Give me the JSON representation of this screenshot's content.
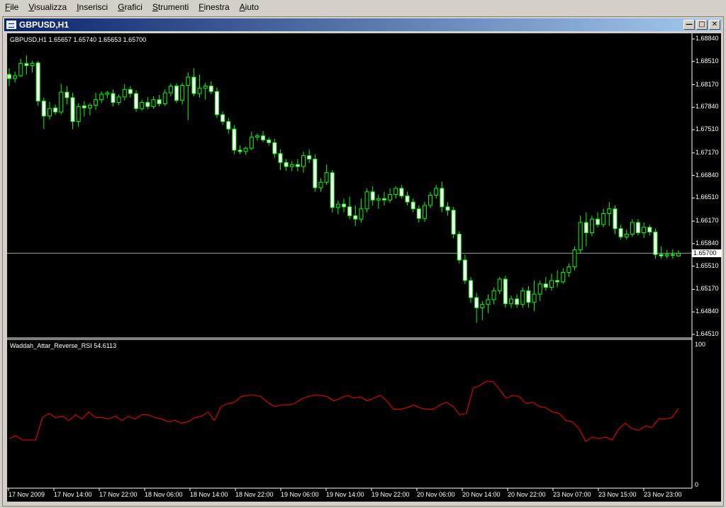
{
  "menu": [
    {
      "label": "File",
      "key": "F",
      "rest": "ile"
    },
    {
      "label": "Visualizza",
      "key": "V",
      "rest": "isualizza"
    },
    {
      "label": "Inserisci",
      "key": "I",
      "rest": "nserisci"
    },
    {
      "label": "Grafici",
      "key": "G",
      "rest": "rafici"
    },
    {
      "label": "Strumenti",
      "key": "S",
      "rest": "trumenti"
    },
    {
      "label": "Finestra",
      "key": "F",
      "rest": "inestra"
    },
    {
      "label": "Aiuto",
      "key": "A",
      "rest": "iuto"
    }
  ],
  "window": {
    "title": "GBPUSD,H1"
  },
  "chart": {
    "header": "GBPUSD,H1  1.65657 1.65740 1.65653 1.65700",
    "current_price": "1.65700",
    "price_labels": [
      "1.68840",
      "1.68510",
      "1.68170",
      "1.67840",
      "1.67510",
      "1.67170",
      "1.66840",
      "1.66510",
      "1.66170",
      "1.65840",
      "1.65510",
      "1.65170",
      "1.64840",
      "1.64510"
    ],
    "indicator_label": "Waddah_Attar_Reverse_RSI 54.6113",
    "indicator_max": "100",
    "indicator_min": "0",
    "time_labels": [
      "17 Nov 2009",
      "17 Nov 14:00",
      "17 Nov 22:00",
      "18 Nov 06:00",
      "18 Nov 14:00",
      "18 Nov 22:00",
      "19 Nov 06:00",
      "19 Nov 14:00",
      "19 Nov 22:00",
      "20 Nov 06:00",
      "20 Nov 14:00",
      "20 Nov 22:00",
      "23 Nov 07:00",
      "23 Nov 15:00",
      "23 Nov 23:00"
    ]
  },
  "chart_data": {
    "type": "candlestick",
    "symbol": "GBPUSD",
    "timeframe": "H1",
    "y_range": [
      1.6451,
      1.6884
    ],
    "bull_color": "#00ff00",
    "bear_color": "#ffffff",
    "rsi_color": "#ff0000",
    "candles": [
      {
        "o": 1.6832,
        "h": 1.6841,
        "l": 1.6815,
        "c": 1.6826
      },
      {
        "o": 1.6826,
        "h": 1.6836,
        "l": 1.682,
        "c": 1.683
      },
      {
        "o": 1.683,
        "h": 1.6855,
        "l": 1.6828,
        "c": 1.6848
      },
      {
        "o": 1.6848,
        "h": 1.686,
        "l": 1.6832,
        "c": 1.6845
      },
      {
        "o": 1.6845,
        "h": 1.6852,
        "l": 1.6835,
        "c": 1.6848
      },
      {
        "o": 1.6849,
        "h": 1.6852,
        "l": 1.6786,
        "c": 1.6793
      },
      {
        "o": 1.6793,
        "h": 1.6798,
        "l": 1.6752,
        "c": 1.6771
      },
      {
        "o": 1.6771,
        "h": 1.6792,
        "l": 1.6766,
        "c": 1.6782
      },
      {
        "o": 1.6783,
        "h": 1.6788,
        "l": 1.6773,
        "c": 1.6777
      },
      {
        "o": 1.6777,
        "h": 1.6818,
        "l": 1.6773,
        "c": 1.6806
      },
      {
        "o": 1.6806,
        "h": 1.6815,
        "l": 1.6788,
        "c": 1.6798
      },
      {
        "o": 1.6798,
        "h": 1.6805,
        "l": 1.6752,
        "c": 1.6763
      },
      {
        "o": 1.6763,
        "h": 1.679,
        "l": 1.6755,
        "c": 1.6785
      },
      {
        "o": 1.6786,
        "h": 1.6793,
        "l": 1.677,
        "c": 1.6783
      },
      {
        "o": 1.6783,
        "h": 1.679,
        "l": 1.6772,
        "c": 1.6787
      },
      {
        "o": 1.6787,
        "h": 1.6805,
        "l": 1.678,
        "c": 1.6795
      },
      {
        "o": 1.6795,
        "h": 1.6807,
        "l": 1.679,
        "c": 1.6803
      },
      {
        "o": 1.6803,
        "h": 1.6808,
        "l": 1.6797,
        "c": 1.6805
      },
      {
        "o": 1.6804,
        "h": 1.681,
        "l": 1.6785,
        "c": 1.6791
      },
      {
        "o": 1.6791,
        "h": 1.6803,
        "l": 1.6787,
        "c": 1.6799
      },
      {
        "o": 1.6799,
        "h": 1.6818,
        "l": 1.6794,
        "c": 1.681
      },
      {
        "o": 1.681,
        "h": 1.6815,
        "l": 1.6798,
        "c": 1.6804
      },
      {
        "o": 1.6804,
        "h": 1.6809,
        "l": 1.6777,
        "c": 1.6782
      },
      {
        "o": 1.6782,
        "h": 1.6795,
        "l": 1.6779,
        "c": 1.6791
      },
      {
        "o": 1.6791,
        "h": 1.6799,
        "l": 1.6781,
        "c": 1.6785
      },
      {
        "o": 1.6785,
        "h": 1.68,
        "l": 1.6782,
        "c": 1.6795
      },
      {
        "o": 1.6795,
        "h": 1.6802,
        "l": 1.6785,
        "c": 1.6789
      },
      {
        "o": 1.6789,
        "h": 1.681,
        "l": 1.6786,
        "c": 1.6805
      },
      {
        "o": 1.6805,
        "h": 1.6819,
        "l": 1.68,
        "c": 1.6815
      },
      {
        "o": 1.6815,
        "h": 1.6819,
        "l": 1.679,
        "c": 1.6794
      },
      {
        "o": 1.6794,
        "h": 1.682,
        "l": 1.6788,
        "c": 1.6816
      },
      {
        "o": 1.6816,
        "h": 1.6835,
        "l": 1.6765,
        "c": 1.6828
      },
      {
        "o": 1.6828,
        "h": 1.6841,
        "l": 1.68,
        "c": 1.6804
      },
      {
        "o": 1.6804,
        "h": 1.6832,
        "l": 1.6798,
        "c": 1.6812
      },
      {
        "o": 1.6812,
        "h": 1.682,
        "l": 1.6795,
        "c": 1.6815
      },
      {
        "o": 1.6815,
        "h": 1.6822,
        "l": 1.6803,
        "c": 1.6807
      },
      {
        "o": 1.6807,
        "h": 1.6813,
        "l": 1.6768,
        "c": 1.6773
      },
      {
        "o": 1.6773,
        "h": 1.6778,
        "l": 1.6758,
        "c": 1.6763
      },
      {
        "o": 1.6763,
        "h": 1.6768,
        "l": 1.6745,
        "c": 1.6752
      },
      {
        "o": 1.6752,
        "h": 1.6758,
        "l": 1.6715,
        "c": 1.6721
      },
      {
        "o": 1.6721,
        "h": 1.6728,
        "l": 1.6715,
        "c": 1.6719
      },
      {
        "o": 1.6719,
        "h": 1.6726,
        "l": 1.6714,
        "c": 1.6724
      },
      {
        "o": 1.6724,
        "h": 1.6748,
        "l": 1.6721,
        "c": 1.674
      },
      {
        "o": 1.674,
        "h": 1.6745,
        "l": 1.6735,
        "c": 1.6742
      },
      {
        "o": 1.6742,
        "h": 1.6749,
        "l": 1.6733,
        "c": 1.6736
      },
      {
        "o": 1.6736,
        "h": 1.674,
        "l": 1.6728,
        "c": 1.6732
      },
      {
        "o": 1.6732,
        "h": 1.6738,
        "l": 1.671,
        "c": 1.6716
      },
      {
        "o": 1.6716,
        "h": 1.6722,
        "l": 1.6692,
        "c": 1.6703
      },
      {
        "o": 1.6703,
        "h": 1.6708,
        "l": 1.6691,
        "c": 1.6697
      },
      {
        "o": 1.6697,
        "h": 1.6705,
        "l": 1.669,
        "c": 1.67
      },
      {
        "o": 1.67,
        "h": 1.6708,
        "l": 1.669,
        "c": 1.6697
      },
      {
        "o": 1.6697,
        "h": 1.6719,
        "l": 1.6688,
        "c": 1.6713
      },
      {
        "o": 1.6713,
        "h": 1.6722,
        "l": 1.6702,
        "c": 1.6708
      },
      {
        "o": 1.6708,
        "h": 1.6715,
        "l": 1.666,
        "c": 1.6666
      },
      {
        "o": 1.6666,
        "h": 1.668,
        "l": 1.666,
        "c": 1.6674
      },
      {
        "o": 1.6674,
        "h": 1.67,
        "l": 1.667,
        "c": 1.6688
      },
      {
        "o": 1.6688,
        "h": 1.6692,
        "l": 1.663,
        "c": 1.6637
      },
      {
        "o": 1.6637,
        "h": 1.6647,
        "l": 1.6627,
        "c": 1.6642
      },
      {
        "o": 1.6642,
        "h": 1.665,
        "l": 1.663,
        "c": 1.6638
      },
      {
        "o": 1.6638,
        "h": 1.6653,
        "l": 1.662,
        "c": 1.6625
      },
      {
        "o": 1.6625,
        "h": 1.664,
        "l": 1.661,
        "c": 1.662
      },
      {
        "o": 1.662,
        "h": 1.665,
        "l": 1.6615,
        "c": 1.6635
      },
      {
        "o": 1.6635,
        "h": 1.6665,
        "l": 1.663,
        "c": 1.666
      },
      {
        "o": 1.666,
        "h": 1.6668,
        "l": 1.664,
        "c": 1.6648
      },
      {
        "o": 1.6648,
        "h": 1.6656,
        "l": 1.6635,
        "c": 1.665
      },
      {
        "o": 1.665,
        "h": 1.666,
        "l": 1.664,
        "c": 1.6648
      },
      {
        "o": 1.6648,
        "h": 1.6665,
        "l": 1.6644,
        "c": 1.6656
      },
      {
        "o": 1.6656,
        "h": 1.6668,
        "l": 1.665,
        "c": 1.6665
      },
      {
        "o": 1.6665,
        "h": 1.667,
        "l": 1.665,
        "c": 1.6654
      },
      {
        "o": 1.6654,
        "h": 1.666,
        "l": 1.664,
        "c": 1.6645
      },
      {
        "o": 1.6645,
        "h": 1.665,
        "l": 1.663,
        "c": 1.6635
      },
      {
        "o": 1.6635,
        "h": 1.664,
        "l": 1.6615,
        "c": 1.6621
      },
      {
        "o": 1.6621,
        "h": 1.6645,
        "l": 1.6616,
        "c": 1.664
      },
      {
        "o": 1.664,
        "h": 1.666,
        "l": 1.6636,
        "c": 1.6655
      },
      {
        "o": 1.6655,
        "h": 1.667,
        "l": 1.665,
        "c": 1.6665
      },
      {
        "o": 1.6665,
        "h": 1.6675,
        "l": 1.663,
        "c": 1.6638
      },
      {
        "o": 1.6638,
        "h": 1.6645,
        "l": 1.6625,
        "c": 1.6633
      },
      {
        "o": 1.6633,
        "h": 1.6638,
        "l": 1.6592,
        "c": 1.6598
      },
      {
        "o": 1.6598,
        "h": 1.6602,
        "l": 1.6555,
        "c": 1.656
      },
      {
        "o": 1.656,
        "h": 1.6568,
        "l": 1.6525,
        "c": 1.653
      },
      {
        "o": 1.653,
        "h": 1.6535,
        "l": 1.6497,
        "c": 1.6505
      },
      {
        "o": 1.6505,
        "h": 1.6512,
        "l": 1.6468,
        "c": 1.649
      },
      {
        "o": 1.649,
        "h": 1.65,
        "l": 1.6472,
        "c": 1.6495
      },
      {
        "o": 1.6495,
        "h": 1.651,
        "l": 1.6482,
        "c": 1.6502
      },
      {
        "o": 1.6502,
        "h": 1.652,
        "l": 1.6495,
        "c": 1.6515
      },
      {
        "o": 1.6515,
        "h": 1.6535,
        "l": 1.651,
        "c": 1.6532
      },
      {
        "o": 1.6532,
        "h": 1.6537,
        "l": 1.649,
        "c": 1.6496
      },
      {
        "o": 1.6496,
        "h": 1.6508,
        "l": 1.649,
        "c": 1.6503
      },
      {
        "o": 1.6503,
        "h": 1.651,
        "l": 1.649,
        "c": 1.6495
      },
      {
        "o": 1.6495,
        "h": 1.652,
        "l": 1.649,
        "c": 1.6515
      },
      {
        "o": 1.6515,
        "h": 1.6522,
        "l": 1.649,
        "c": 1.6498
      },
      {
        "o": 1.6498,
        "h": 1.653,
        "l": 1.6485,
        "c": 1.651
      },
      {
        "o": 1.651,
        "h": 1.653,
        "l": 1.65,
        "c": 1.6525
      },
      {
        "o": 1.6525,
        "h": 1.6535,
        "l": 1.6515,
        "c": 1.652
      },
      {
        "o": 1.652,
        "h": 1.654,
        "l": 1.6515,
        "c": 1.653
      },
      {
        "o": 1.653,
        "h": 1.6545,
        "l": 1.652,
        "c": 1.6528
      },
      {
        "o": 1.6528,
        "h": 1.6548,
        "l": 1.6525,
        "c": 1.6542
      },
      {
        "o": 1.6542,
        "h": 1.6555,
        "l": 1.6535,
        "c": 1.655
      },
      {
        "o": 1.655,
        "h": 1.658,
        "l": 1.6545,
        "c": 1.6575
      },
      {
        "o": 1.6575,
        "h": 1.6625,
        "l": 1.657,
        "c": 1.6615
      },
      {
        "o": 1.6615,
        "h": 1.663,
        "l": 1.658,
        "c": 1.66
      },
      {
        "o": 1.66,
        "h": 1.6625,
        "l": 1.6595,
        "c": 1.662
      },
      {
        "o": 1.662,
        "h": 1.663,
        "l": 1.6608,
        "c": 1.6612
      },
      {
        "o": 1.6612,
        "h": 1.6635,
        "l": 1.6608,
        "c": 1.6628
      },
      {
        "o": 1.6628,
        "h": 1.6645,
        "l": 1.661,
        "c": 1.6635
      },
      {
        "o": 1.6635,
        "h": 1.664,
        "l": 1.6598,
        "c": 1.6606
      },
      {
        "o": 1.6606,
        "h": 1.6612,
        "l": 1.659,
        "c": 1.6594
      },
      {
        "o": 1.6594,
        "h": 1.6605,
        "l": 1.659,
        "c": 1.6598
      },
      {
        "o": 1.6598,
        "h": 1.662,
        "l": 1.6594,
        "c": 1.6615
      },
      {
        "o": 1.6615,
        "h": 1.662,
        "l": 1.6596,
        "c": 1.66
      },
      {
        "o": 1.66,
        "h": 1.6615,
        "l": 1.6592,
        "c": 1.6608
      },
      {
        "o": 1.6608,
        "h": 1.6612,
        "l": 1.6596,
        "c": 1.6601
      },
      {
        "o": 1.6601,
        "h": 1.6606,
        "l": 1.6562,
        "c": 1.6568
      },
      {
        "o": 1.6568,
        "h": 1.658,
        "l": 1.6562,
        "c": 1.6566
      },
      {
        "o": 1.6566,
        "h": 1.6575,
        "l": 1.6562,
        "c": 1.6568
      },
      {
        "o": 1.6568,
        "h": 1.6576,
        "l": 1.6562,
        "c": 1.6567
      },
      {
        "o": 1.6566,
        "h": 1.6574,
        "l": 1.6565,
        "c": 1.657
      }
    ],
    "rsi_range": [
      0,
      100
    ],
    "rsi_values": [
      33,
      35,
      32,
      32,
      32,
      48,
      51,
      48,
      49,
      46,
      50,
      47,
      52,
      48,
      48,
      47,
      49,
      46,
      49,
      47,
      50,
      50,
      48,
      47,
      45,
      46,
      44,
      45,
      48,
      49,
      52,
      46,
      56,
      58,
      59,
      63,
      64,
      64,
      63,
      59,
      56,
      57,
      57,
      58,
      61,
      63,
      64,
      64,
      63,
      60,
      62,
      64,
      62,
      63,
      60,
      62,
      64,
      60,
      54,
      54,
      55,
      57,
      55,
      54,
      54,
      57,
      59,
      56,
      50,
      51,
      69,
      71,
      74,
      74,
      68,
      62,
      64,
      63,
      58,
      59,
      56,
      55,
      52,
      51,
      46,
      45,
      40,
      31,
      34,
      33,
      34,
      32,
      40,
      44,
      40,
      39,
      42,
      41,
      47,
      47,
      48,
      54.6113
    ]
  }
}
